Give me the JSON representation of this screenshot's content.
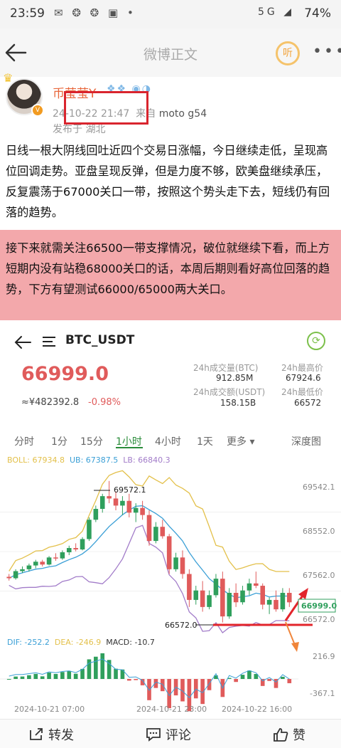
{
  "status_bar": {
    "time": "23:59",
    "left_icons": "✉ ❂ ❂ ▣ •",
    "right_icons": "5G ◢",
    "battery": "74%",
    "icon_names": [
      "wechat-icon",
      "weibo-icon",
      "weibo-icon",
      "app-icon",
      "dot-icon",
      "mute-icon",
      "vibrate-icon",
      "signal-icon",
      "battery-icon"
    ]
  },
  "nav": {
    "title": "微博正文",
    "listen_label": "听"
  },
  "post": {
    "username": "币莹莹Y",
    "badges": "❖❖ ◉◑",
    "timestamp": "24-10-22 21:47",
    "source_prefix": "来自",
    "source_device": "moto g54",
    "location": "发布于 湖北",
    "paragraph1": "日线一根大阴线回吐近四个交易日涨幅，今日继续走低，呈现高位回调走势。亚盘呈现反弹，但是力度不够，欧美盘继续承压，反复震荡于67000关口一带，按照这个势头走下去，短线仍有回落的趋势。",
    "paragraph2": "接下来就需关注66500一带支撑情况，破位就继续下看，而上方短期内没有站稳68000关口的话，本周后期则看好高位回落的趋势，下方有望测试66000/65000两大关口。"
  },
  "trade": {
    "pair": "BTC_USDT",
    "price": "66999.0",
    "cny": "≈¥482392.8",
    "change": "-0.98%",
    "stats": {
      "r0_lbl_a": "24h成交量(BTC)",
      "r0_lbl_b": "24h最高价",
      "r1_a": "912.85M",
      "r1_b": "67924.6",
      "r2_lbl_a": "24h成交额(USDT)",
      "r2_lbl_b": "24h最低价",
      "r3_a": "158.15B",
      "r3_b": "66572"
    },
    "tabs": [
      "分时",
      "1分",
      "15分",
      "1小时",
      "4小时",
      "1天",
      "更多 ▾",
      "深度图"
    ],
    "active_tab": "1小时",
    "boll": {
      "boll": "BOLL: 67934.8",
      "ub": "UB: 67387.5",
      "lb": "LB: 66840.3"
    },
    "macd": {
      "dif": "DIF: -252.2",
      "dea": "DEA: -246.9",
      "macd": "MACD: -10.7"
    },
    "annotations": {
      "high": "69572.1",
      "low": "66572.0",
      "current": "66999.0"
    },
    "y_axis": [
      "69542.1",
      "68552.0",
      "67562.0",
      "66572.0"
    ],
    "macd_axis": [
      "216.9",
      "-367.1"
    ],
    "x_axis": [
      "2024-10-21 07:00",
      "2024-10-21 23:00",
      "2024-10-22 16:00"
    ],
    "colors": {
      "up": "#2f9f5c",
      "down": "#e05b5b",
      "boll_mid": "#3a9fd6",
      "boll_up": "#e3c04a",
      "boll_low": "#a27cc9",
      "annotation": "#e2242b"
    },
    "candles": [
      [
        67540,
        67600,
        67460,
        67510
      ],
      [
        67510,
        67700,
        67480,
        67660
      ],
      [
        67660,
        67760,
        67620,
        67700
      ],
      [
        67700,
        67820,
        67650,
        67780
      ],
      [
        67780,
        67900,
        67720,
        67860
      ],
      [
        67860,
        67900,
        67760,
        67800
      ],
      [
        67800,
        67980,
        67780,
        67950
      ],
      [
        67950,
        68040,
        67880,
        67930
      ],
      [
        67930,
        68100,
        67900,
        68060
      ],
      [
        68060,
        68200,
        68000,
        68150
      ],
      [
        68150,
        68250,
        68080,
        68120
      ],
      [
        68120,
        68380,
        68100,
        68340
      ],
      [
        68340,
        68800,
        68300,
        68750
      ],
      [
        68750,
        69050,
        68700,
        68980
      ],
      [
        68980,
        69300,
        68900,
        69250
      ],
      [
        69250,
        69572,
        69100,
        69200
      ],
      [
        69200,
        69350,
        68950,
        69050
      ],
      [
        69050,
        69250,
        68850,
        69150
      ],
      [
        69150,
        69300,
        68800,
        68900
      ],
      [
        68900,
        69100,
        68700,
        69000
      ],
      [
        69000,
        69150,
        68750,
        68850
      ],
      [
        68850,
        68950,
        68200,
        68300
      ],
      [
        68300,
        68700,
        68250,
        68600
      ],
      [
        68600,
        68750,
        68350,
        68400
      ],
      [
        68400,
        68450,
        67600,
        67700
      ],
      [
        67700,
        68050,
        67650,
        67950
      ],
      [
        67950,
        68100,
        67500,
        67600
      ],
      [
        67600,
        67700,
        66900,
        67050
      ],
      [
        67050,
        67350,
        66950,
        67250
      ],
      [
        67250,
        67450,
        66800,
        66900
      ],
      [
        66900,
        67250,
        66850,
        67150
      ],
      [
        67150,
        67600,
        67100,
        67500
      ],
      [
        67500,
        67650,
        66572,
        66700
      ],
      [
        66700,
        67300,
        66650,
        67200
      ],
      [
        67200,
        67400,
        66900,
        67000
      ],
      [
        67000,
        67350,
        66950,
        67250
      ],
      [
        67250,
        67500,
        67150,
        67400
      ],
      [
        67400,
        67650,
        67300,
        67350
      ],
      [
        67350,
        67400,
        66850,
        66950
      ],
      [
        66950,
        67100,
        66750,
        67050
      ],
      [
        67050,
        67250,
        66800,
        66850
      ],
      [
        66850,
        67300,
        66800,
        67200
      ],
      [
        67200,
        67300,
        66900,
        66999
      ]
    ]
  },
  "actions": {
    "repost": "转发",
    "comment": "评论",
    "like": "赞"
  }
}
